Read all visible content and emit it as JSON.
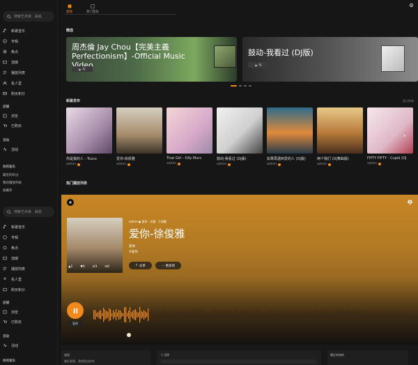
{
  "sidebar": {
    "search_placeholder": "搜索艺术家、曲名",
    "nav": [
      {
        "label": "新歌音乐",
        "icon": "music-note-icon"
      },
      {
        "label": "专辑",
        "icon": "album-icon"
      },
      {
        "label": "焦点",
        "icon": "focus-icon"
      },
      {
        "label": "流媒",
        "icon": "stream-icon"
      },
      {
        "label": "播放列表",
        "icon": "playlist-icon"
      },
      {
        "label": "名人堂",
        "icon": "hall-of-fame-icon"
      },
      {
        "label": "购买积分",
        "icon": "credits-icon"
      }
    ],
    "section_browse": "店铺",
    "browse_items": [
      {
        "label": "浏览",
        "icon": "browse-icon"
      },
      {
        "label": "已购买",
        "icon": "purchased-icon"
      }
    ],
    "section_activity": "活动",
    "activity_item": {
      "label": "活动",
      "icon": "activity-icon"
    },
    "section_my": "你的音乐",
    "my_items": [
      "最近的听过",
      "我的播放列表",
      "收藏夹"
    ]
  },
  "tabs": [
    {
      "label": "发现",
      "active": true,
      "icon": "discover-icon"
    },
    {
      "label": "热门音乐",
      "active": false,
      "icon": "hot-music-icon"
    }
  ],
  "featured": {
    "heading": "精选",
    "banners": [
      {
        "title": "周杰倫 Jay Chou【完美主義 Perfectionism】-Official Music Video",
        "play_label": "玩"
      },
      {
        "title": "鼓动-我看过 (DJ版)",
        "play_label": "玩"
      }
    ]
  },
  "new_releases": {
    "heading": "新歌发布",
    "more": "显示所有",
    "albums": [
      {
        "name": "你是我的人 - Tcoco",
        "artist": "admin"
      },
      {
        "name": "爱你-徐俊雅",
        "artist": "admin"
      },
      {
        "name": "That Girl - Olly Murs",
        "artist": "admin"
      },
      {
        "name": "鼓动-我看过 (DJ版)",
        "artist": "admin"
      },
      {
        "name": "如果再遇到爱的人 (DJ版)",
        "artist": "admin"
      },
      {
        "name": "两个我们 (DJ舞曲版)",
        "artist": "admin"
      },
      {
        "name": "FIFTY FIFTY - Cupid (DJ",
        "artist": "admin"
      }
    ]
  },
  "hot_playlists": {
    "heading": "热门播放列表"
  },
  "player": {
    "meta": "admin ● 发布 · 天赋 · 3 热歌",
    "title": "爱你-徐俊雅",
    "subtitle": "爱你",
    "tag": "#爱你",
    "stats": [
      {
        "icon": "like-icon",
        "value": "1"
      },
      {
        "icon": "dislike-icon",
        "value": "0"
      },
      {
        "icon": "share-count-icon",
        "value": "3"
      },
      {
        "icon": "comment-icon",
        "value": "0"
      }
    ],
    "share_label": "分享",
    "more_label": "··· 更多的",
    "pause_label": "暂停"
  },
  "bottom": {
    "about": "说说",
    "about_text": "美好爱情、我就是这样的",
    "comment_count": "1 注释",
    "latest": "最近有效的"
  },
  "mini_sidebar": {
    "search_placeholder": "搜索艺术家、曲名",
    "nav": [
      "新歌音乐",
      "专辑",
      "焦点",
      "流媒",
      "播放列表",
      "名人堂",
      "购买积分"
    ],
    "section_browse": "店铺",
    "browse_items": [
      "浏览",
      "已购买"
    ],
    "section_activity": "活动",
    "activity_item": "活动",
    "section_my": "你的音乐"
  },
  "colors": {
    "accent": "#f08a1c",
    "bg": "#161616"
  }
}
